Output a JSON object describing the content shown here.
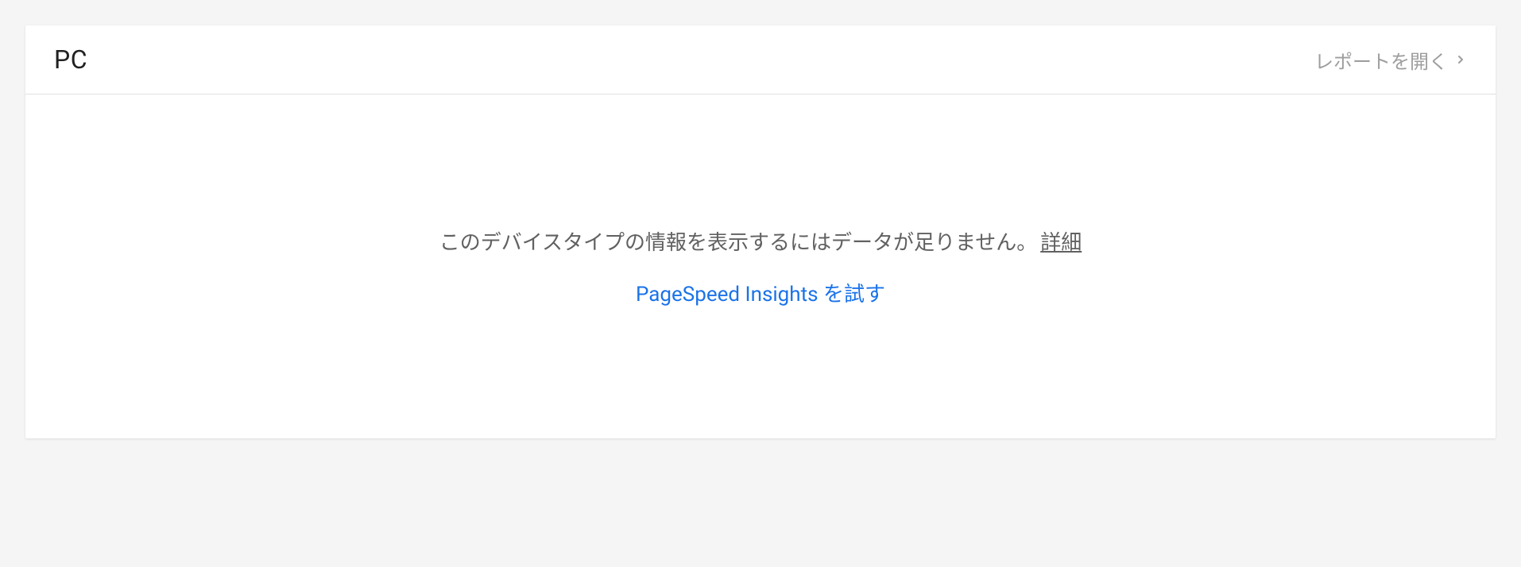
{
  "card": {
    "title": "PC",
    "open_report_label": "レポートを開く"
  },
  "body": {
    "insufficient_data_message": "このデバイスタイプの情報を表示するにはデータが足りません。",
    "details_link": "詳細",
    "psi_link": "PageSpeed Insights を試す"
  },
  "colors": {
    "link": "#1a73e8",
    "text_secondary": "#616161",
    "text_muted": "#9e9e9e"
  }
}
